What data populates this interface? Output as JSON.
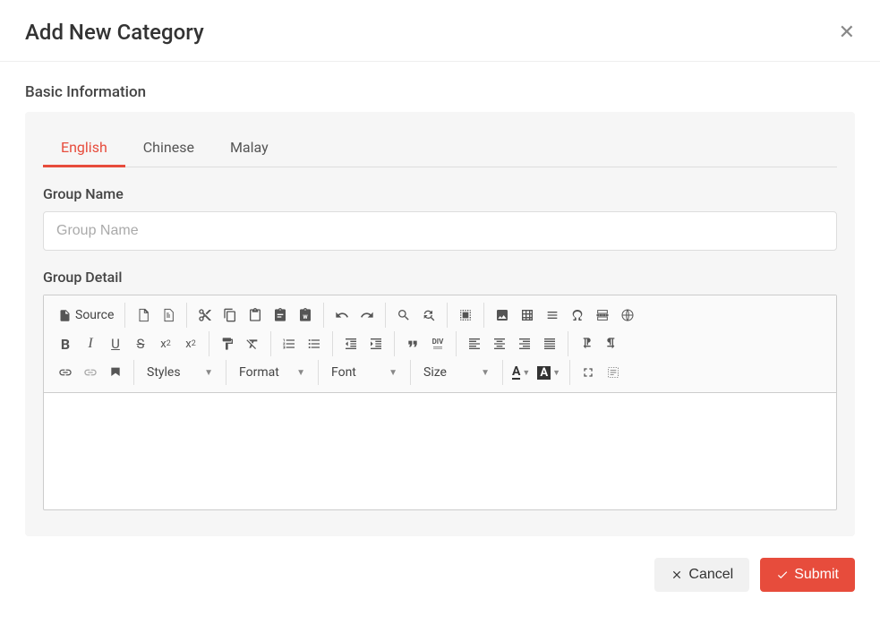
{
  "header": {
    "title": "Add New Category"
  },
  "section": {
    "title": "Basic Information"
  },
  "tabs": [
    {
      "label": "English",
      "active": true
    },
    {
      "label": "Chinese",
      "active": false
    },
    {
      "label": "Malay",
      "active": false
    }
  ],
  "fields": {
    "groupName": {
      "label": "Group Name",
      "placeholder": "Group Name",
      "value": ""
    },
    "groupDetail": {
      "label": "Group Detail"
    }
  },
  "editor": {
    "source_label": "Source",
    "dropdowns": {
      "styles": "Styles",
      "format": "Format",
      "font": "Font",
      "size": "Size"
    }
  },
  "footer": {
    "cancel": "Cancel",
    "submit": "Submit"
  }
}
